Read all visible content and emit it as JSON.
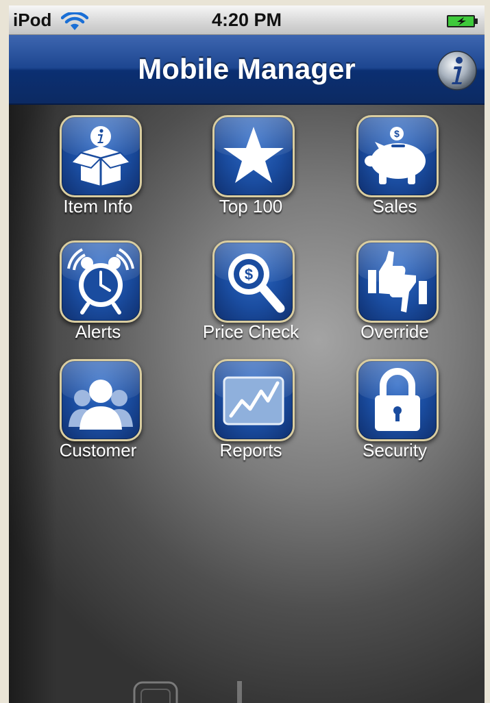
{
  "status_bar": {
    "carrier": "iPod",
    "time": "4:20 PM",
    "wifi_icon": "wifi-icon",
    "battery_icon": "battery-charging-icon"
  },
  "nav_bar": {
    "title": "Mobile Manager",
    "info_icon": "info-icon"
  },
  "apps": [
    {
      "label": "Item Info",
      "icon": "item-info-box-icon"
    },
    {
      "label": "Top 100",
      "icon": "star-icon"
    },
    {
      "label": "Sales",
      "icon": "piggy-bank-icon"
    },
    {
      "label": "Alerts",
      "icon": "alarm-clock-icon"
    },
    {
      "label": "Price Check",
      "icon": "magnifier-dollar-icon"
    },
    {
      "label": "Override",
      "icon": "thumbs-icon"
    },
    {
      "label": "Customer",
      "icon": "people-icon"
    },
    {
      "label": "Reports",
      "icon": "chart-icon"
    },
    {
      "label": "Security",
      "icon": "padlock-icon"
    }
  ],
  "colors": {
    "nav_blue": "#1d4690",
    "icon_blue": "#1a4c9f",
    "icon_border": "#d9cda0",
    "background_gray": "#7c7c7c"
  }
}
